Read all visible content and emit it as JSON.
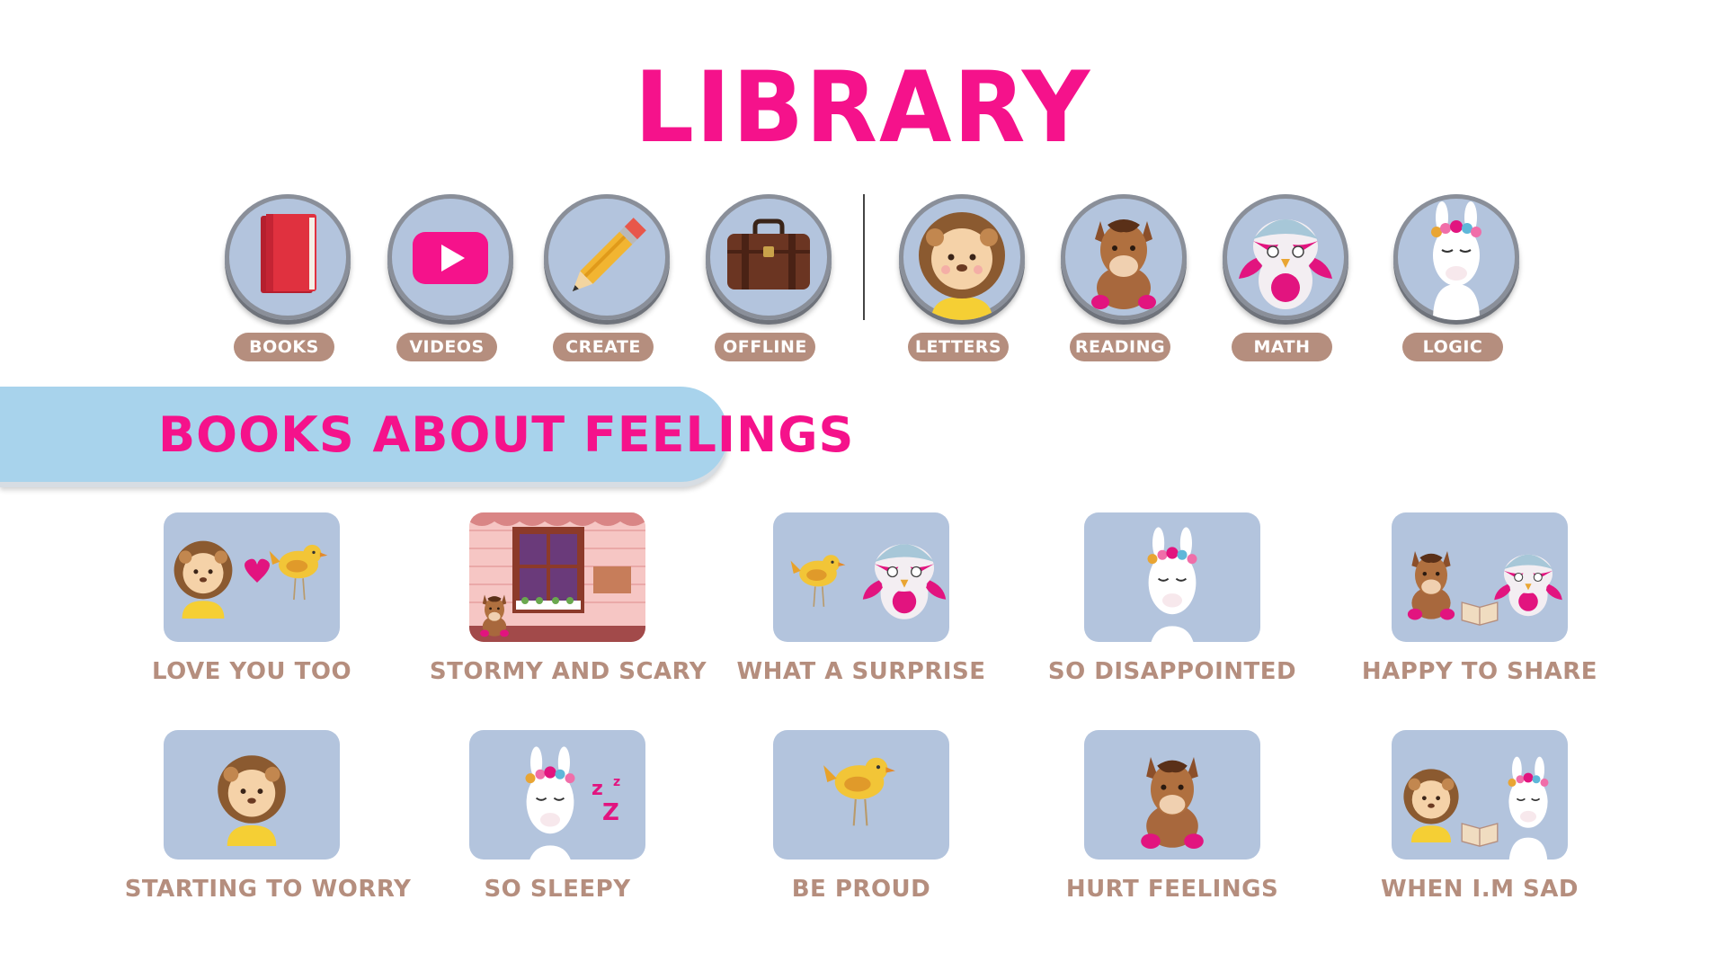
{
  "page": {
    "title": "LIBRARY"
  },
  "nav": {
    "items": [
      {
        "label": "BOOKS",
        "icon": "book-icon"
      },
      {
        "label": "VIDEOS",
        "icon": "video-play-icon"
      },
      {
        "label": "CREATE",
        "icon": "pencil-icon"
      },
      {
        "label": "OFFLINE",
        "icon": "suitcase-icon"
      },
      {
        "label": "LETTERS",
        "icon": "lion-icon"
      },
      {
        "label": "READING",
        "icon": "horse-icon"
      },
      {
        "label": "MATH",
        "icon": "owl-icon"
      },
      {
        "label": "LOGIC",
        "icon": "llama-icon"
      }
    ]
  },
  "section": {
    "title": "BOOKS ABOUT FEELINGS"
  },
  "books": [
    {
      "title": "LOVE YOU TOO",
      "art": "lion-heart-bird"
    },
    {
      "title": "STORMY AND SCARY",
      "art": "horse-window"
    },
    {
      "title": "WHAT A SURPRISE",
      "art": "bird-owl"
    },
    {
      "title": "SO DISAPPOINTED",
      "art": "llama"
    },
    {
      "title": "HAPPY TO SHARE",
      "art": "horse-book-owl"
    },
    {
      "title": "STARTING TO WORRY",
      "art": "lion"
    },
    {
      "title": "SO SLEEPY",
      "art": "llama-sleepy"
    },
    {
      "title": "BE PROUD",
      "art": "bird"
    },
    {
      "title": "HURT FEELINGS",
      "art": "horse"
    },
    {
      "title": "WHEN I.M SAD",
      "art": "lion-book-llama"
    }
  ],
  "colors": {
    "title_pink": "#f5128b",
    "pill_brown": "#b58e7e",
    "tile_blue": "#b3c4dd",
    "banner_blue": "#a8d3ec"
  }
}
